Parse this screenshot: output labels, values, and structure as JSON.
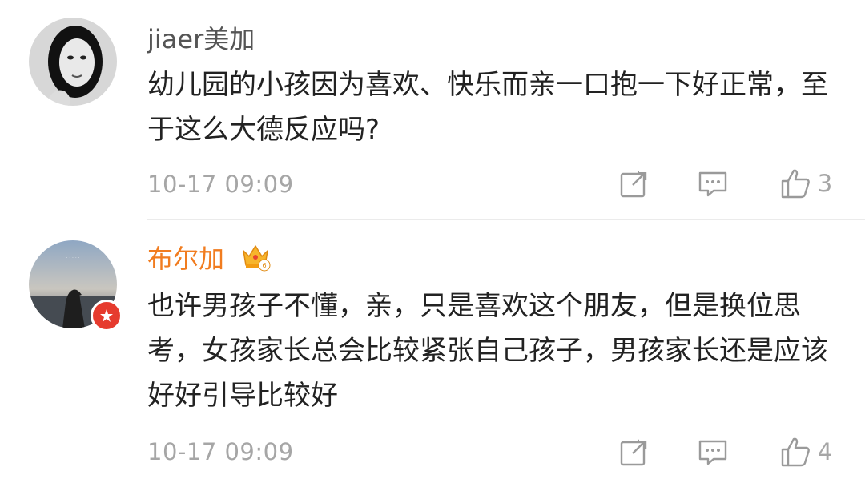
{
  "comments": [
    {
      "username": "jiaer美加",
      "text": "幼儿园的小孩因为喜欢、快乐而亲一口抱一下好正常，至于这么大德反应吗?",
      "time": "10-17 09:09",
      "likes": "3",
      "username_color": "#555555"
    },
    {
      "username": "布尔加",
      "text": "也许男孩子不懂，亲，只是喜欢这个朋友，但是换位思考，女孩家长总会比较紧张自己孩子，男孩家长还是应该好好引导比较好",
      "time": "10-17 09:09",
      "likes": "4",
      "username_color": "#f17c1f"
    }
  ],
  "icons": {
    "repost": "share-icon",
    "comment": "comment-icon",
    "like": "thumbs-up-icon",
    "crown": "crown-badge-icon",
    "vip": "vip-badge-icon"
  },
  "colors": {
    "meta_gray": "#a6a6a6",
    "orange_name": "#f17c1f",
    "badge_red": "#e63b2e"
  }
}
